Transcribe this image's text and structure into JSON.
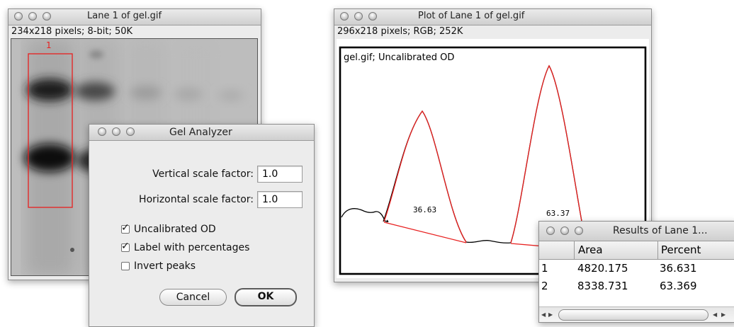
{
  "lane_window": {
    "title": "Lane 1 of gel.gif",
    "info": "234x218 pixels; 8-bit; 50K",
    "lane_label": "1"
  },
  "plot_window": {
    "title": "Plot of Lane 1 of gel.gif",
    "info": "296x218 pixels; RGB; 252K",
    "plot_label": "gel.gif; Uncalibrated OD",
    "peak_labels": [
      "36.63",
      "63.37"
    ]
  },
  "gel_analyzer": {
    "title": "Gel Analyzer",
    "vertical_label": "Vertical scale factor:",
    "vertical_value": "1.0",
    "horizontal_label": "Horizontal scale factor:",
    "horizontal_value": "1.0",
    "options": [
      {
        "label": "Uncalibrated OD",
        "checked": true
      },
      {
        "label": "Label with percentages",
        "checked": true
      },
      {
        "label": "Invert peaks",
        "checked": false
      }
    ],
    "cancel_label": "Cancel",
    "ok_label": "OK"
  },
  "results_window": {
    "title": "Results of Lane 1...",
    "columns": [
      "",
      "Area",
      "Percent"
    ],
    "rows": [
      [
        "1",
        "4820.175",
        "36.631"
      ],
      [
        "2",
        "8338.731",
        "63.369"
      ]
    ]
  },
  "colors": {
    "selection_red": "#e8201f",
    "plot_black": "#000000"
  }
}
